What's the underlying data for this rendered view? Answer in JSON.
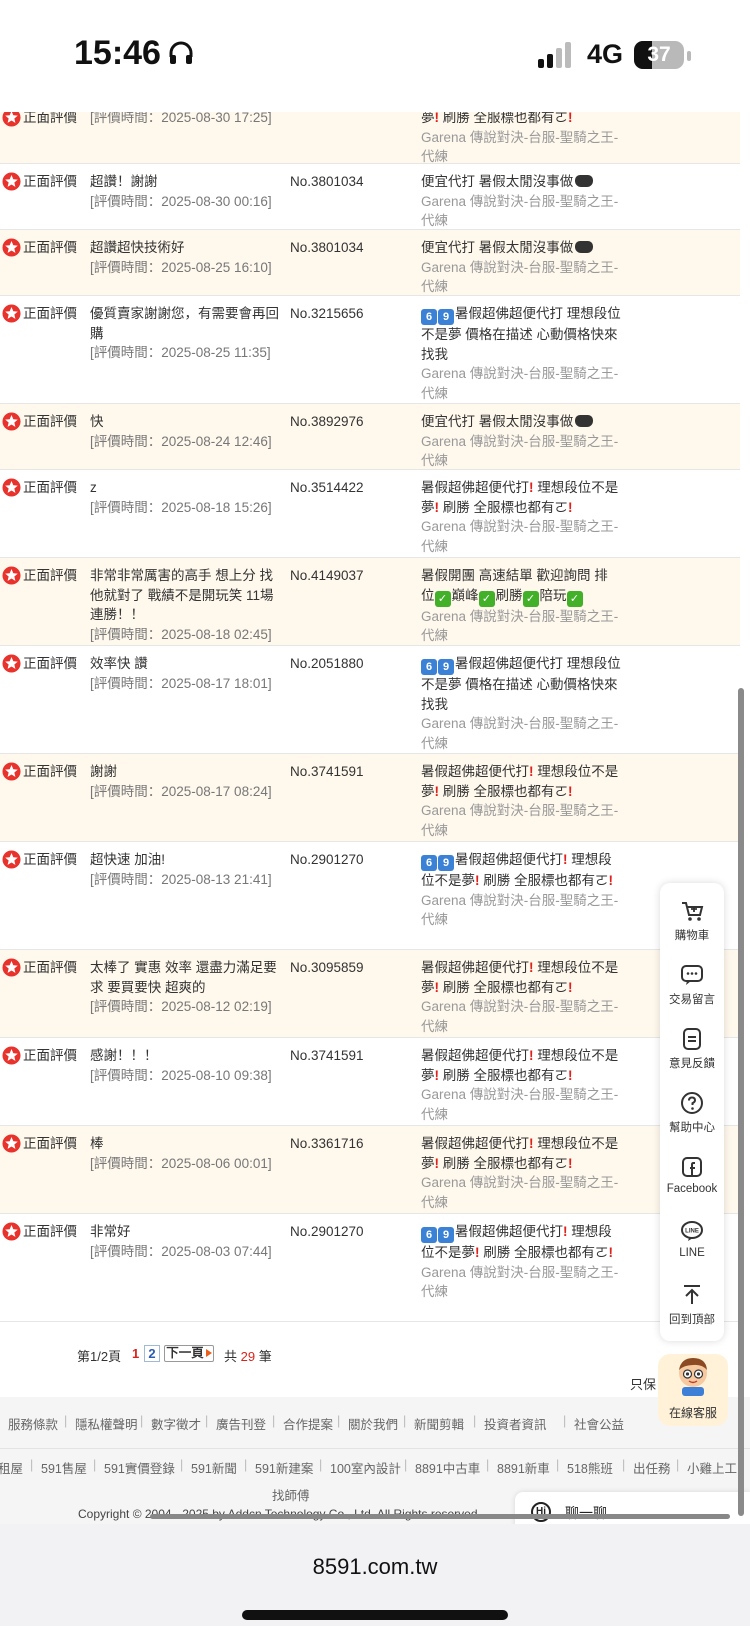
{
  "status_bar": {
    "time": "15:46",
    "network": "4G",
    "battery": "37"
  },
  "reviews": [
    {
      "badge": "正面評價",
      "comment": "",
      "time": "[評價時間：2025-08-30 17:25]",
      "number": "",
      "product": "夢❗ 刷勝 全服標也都有ㄛ❗",
      "game": "Garena 傳說對決-台服-聖騎之王-代練"
    },
    {
      "badge": "正面評價",
      "comment": "超讚！謝謝",
      "time": "[評價時間：2025-08-30 00:16]",
      "number": "No.3801034",
      "product": "便宜代打 暑假太閒沒事做🎮",
      "game": "Garena 傳說對決-台服-聖騎之王-代練"
    },
    {
      "badge": "正面評價",
      "comment": "超讚超快技術好",
      "time": "[評價時間：2025-08-25 16:10]",
      "number": "No.3801034",
      "product": "便宜代打 暑假太閒沒事做🎮",
      "game": "Garena 傳說對決-台服-聖騎之王-代練"
    },
    {
      "badge": "正面評價",
      "comment": "優質賣家謝謝您，有需要會再回購",
      "time": "[評價時間：2025-08-25 11:35]",
      "number": "No.3215656",
      "product": "6️⃣9️⃣暑假超佛超便代打 理想段位不是夢 價格在描述 心動價格快來找我",
      "game": "Garena 傳說對決-台服-聖騎之王-代練"
    },
    {
      "badge": "正面評價",
      "comment": "快",
      "time": "[評價時間：2025-08-24 12:46]",
      "number": "No.3892976",
      "product": "便宜代打 暑假太閒沒事做🎮",
      "game": "Garena 傳說對決-台服-聖騎之王-代練"
    },
    {
      "badge": "正面評價",
      "comment": "z",
      "time": "[評價時間：2025-08-18 15:26]",
      "number": "No.3514422",
      "product": "暑假超佛超便代打❗ 理想段位不是夢❗ 刷勝 全服標也都有ㄛ❗",
      "game": "Garena 傳說對決-台服-聖騎之王-代練"
    },
    {
      "badge": "正面評價",
      "comment": "非常非常厲害的高手 想上分 找他就對了 戰績不是開玩笑 11場連勝！！",
      "time": "[評價時間：2025-08-18 02:45]",
      "number": "No.4149037",
      "product": "暑假開團 高速結單 歡迎詢問 排位✅巔峰✅刷勝✅陪玩✅",
      "game": "Garena 傳說對決-台服-聖騎之王-代練"
    },
    {
      "badge": "正面評價",
      "comment": "效率快 讚",
      "time": "[評價時間：2025-08-17 18:01]",
      "number": "No.2051880",
      "product": "6️⃣9️⃣暑假超佛超便代打 理想段位不是夢 價格在描述 心動價格快來找我",
      "game": "Garena 傳說對決-台服-聖騎之王-代練"
    },
    {
      "badge": "正面評價",
      "comment": "謝謝",
      "time": "[評價時間：2025-08-17 08:24]",
      "number": "No.3741591",
      "product": "暑假超佛超便代打❗ 理想段位不是夢❗ 刷勝 全服標也都有ㄛ❗",
      "game": "Garena 傳說對決-台服-聖騎之王-代練"
    },
    {
      "badge": "正面評價",
      "comment": "超快速 加油!",
      "time": "[評價時間：2025-08-13 21:41]",
      "number": "No.2901270",
      "product": "6️⃣9️⃣暑假超佛超便代打❗ 理想段位不是夢❗ 刷勝 全服標也都有ㄛ❗",
      "game": "Garena 傳說對決-台服-聖騎之王-代練"
    },
    {
      "badge": "正面評價",
      "comment": "太棒了 實惠 效率 還盡力滿足要求 要買要快 超爽的",
      "time": "[評價時間：2025-08-12 02:19]",
      "number": "No.3095859",
      "product": "暑假超佛超便代打❗ 理想段位不是夢❗ 刷勝 全服標也都有ㄛ❗",
      "game": "Garena 傳說對決-台服-聖騎之王-代練"
    },
    {
      "badge": "正面評價",
      "comment": "感謝！！！",
      "time": "[評價時間：2025-08-10 09:38]",
      "number": "No.3741591",
      "product": "暑假超佛超便代打❗ 理想段位不是夢❗ 刷勝 全服標也都有ㄛ❗",
      "game": "Garena 傳說對決-台服-聖騎之王-代練"
    },
    {
      "badge": "正面評價",
      "comment": "棒",
      "time": "[評價時間：2025-08-06 00:01]",
      "number": "No.3361716",
      "product": "暑假超佛超便代打❗ 理想段位不是夢❗ 刷勝 全服標也都有ㄛ❗",
      "game": "Garena 傳說對決-台服-聖騎之王-代練"
    },
    {
      "badge": "正面評價",
      "comment": "非常好",
      "time": "[評價時間：2025-08-03 07:44]",
      "number": "No.2901270",
      "product": "6️⃣9️⃣暑假超佛超便代打❗ 理想段位不是夢❗ 刷勝 全服標也都有ㄛ❗",
      "game": "Garena 傳說對決-台服-聖騎之王-代練"
    }
  ],
  "pagination": {
    "info": "第1/2頁",
    "current": "1",
    "page2": "2",
    "next": "下一頁",
    "total_prefix": "共",
    "total": "29",
    "total_suffix": "筆"
  },
  "only_show": "只保",
  "footer": {
    "links1": [
      "服務條款",
      "隱私權聲明",
      "數字徵才",
      "廣告刊登",
      "合作提案",
      "關於我們",
      "新聞剪輯",
      "投資者資訊",
      "社會公益"
    ],
    "links2": [
      "租屋",
      "591售屋",
      "591實價登錄",
      "591新聞",
      "591新建案",
      "100室內設計",
      "8891中古車",
      "8891新車",
      "518熊班",
      "出任務",
      "小雞上工"
    ],
    "findmaster": "找師傅",
    "copyright": "Copyright © 2004 - 2025 by Addcn Technology Co., Ltd. All Rights reserved."
  },
  "sidebar": {
    "items": [
      {
        "label": "購物車",
        "icon": "cart-icon"
      },
      {
        "label": "交易留言",
        "icon": "message-icon"
      },
      {
        "label": "意見反饋",
        "icon": "feedback-icon"
      },
      {
        "label": "幫助中心",
        "icon": "help-icon"
      },
      {
        "label": "Facebook",
        "icon": "facebook-icon"
      },
      {
        "label": "LINE",
        "icon": "line-icon"
      },
      {
        "label": "回到頂部",
        "icon": "back-to-top-icon"
      }
    ],
    "service": "在線客服"
  },
  "chat": {
    "label": "聊一聊",
    "icon_text": "Hi"
  },
  "browser": {
    "url": "8591.com.tw"
  },
  "colors": {
    "alt_row": "#fff8ed",
    "badge_red": "#e8322c",
    "accent_red": "#d9241c",
    "link_blue": "#2a5db0"
  }
}
